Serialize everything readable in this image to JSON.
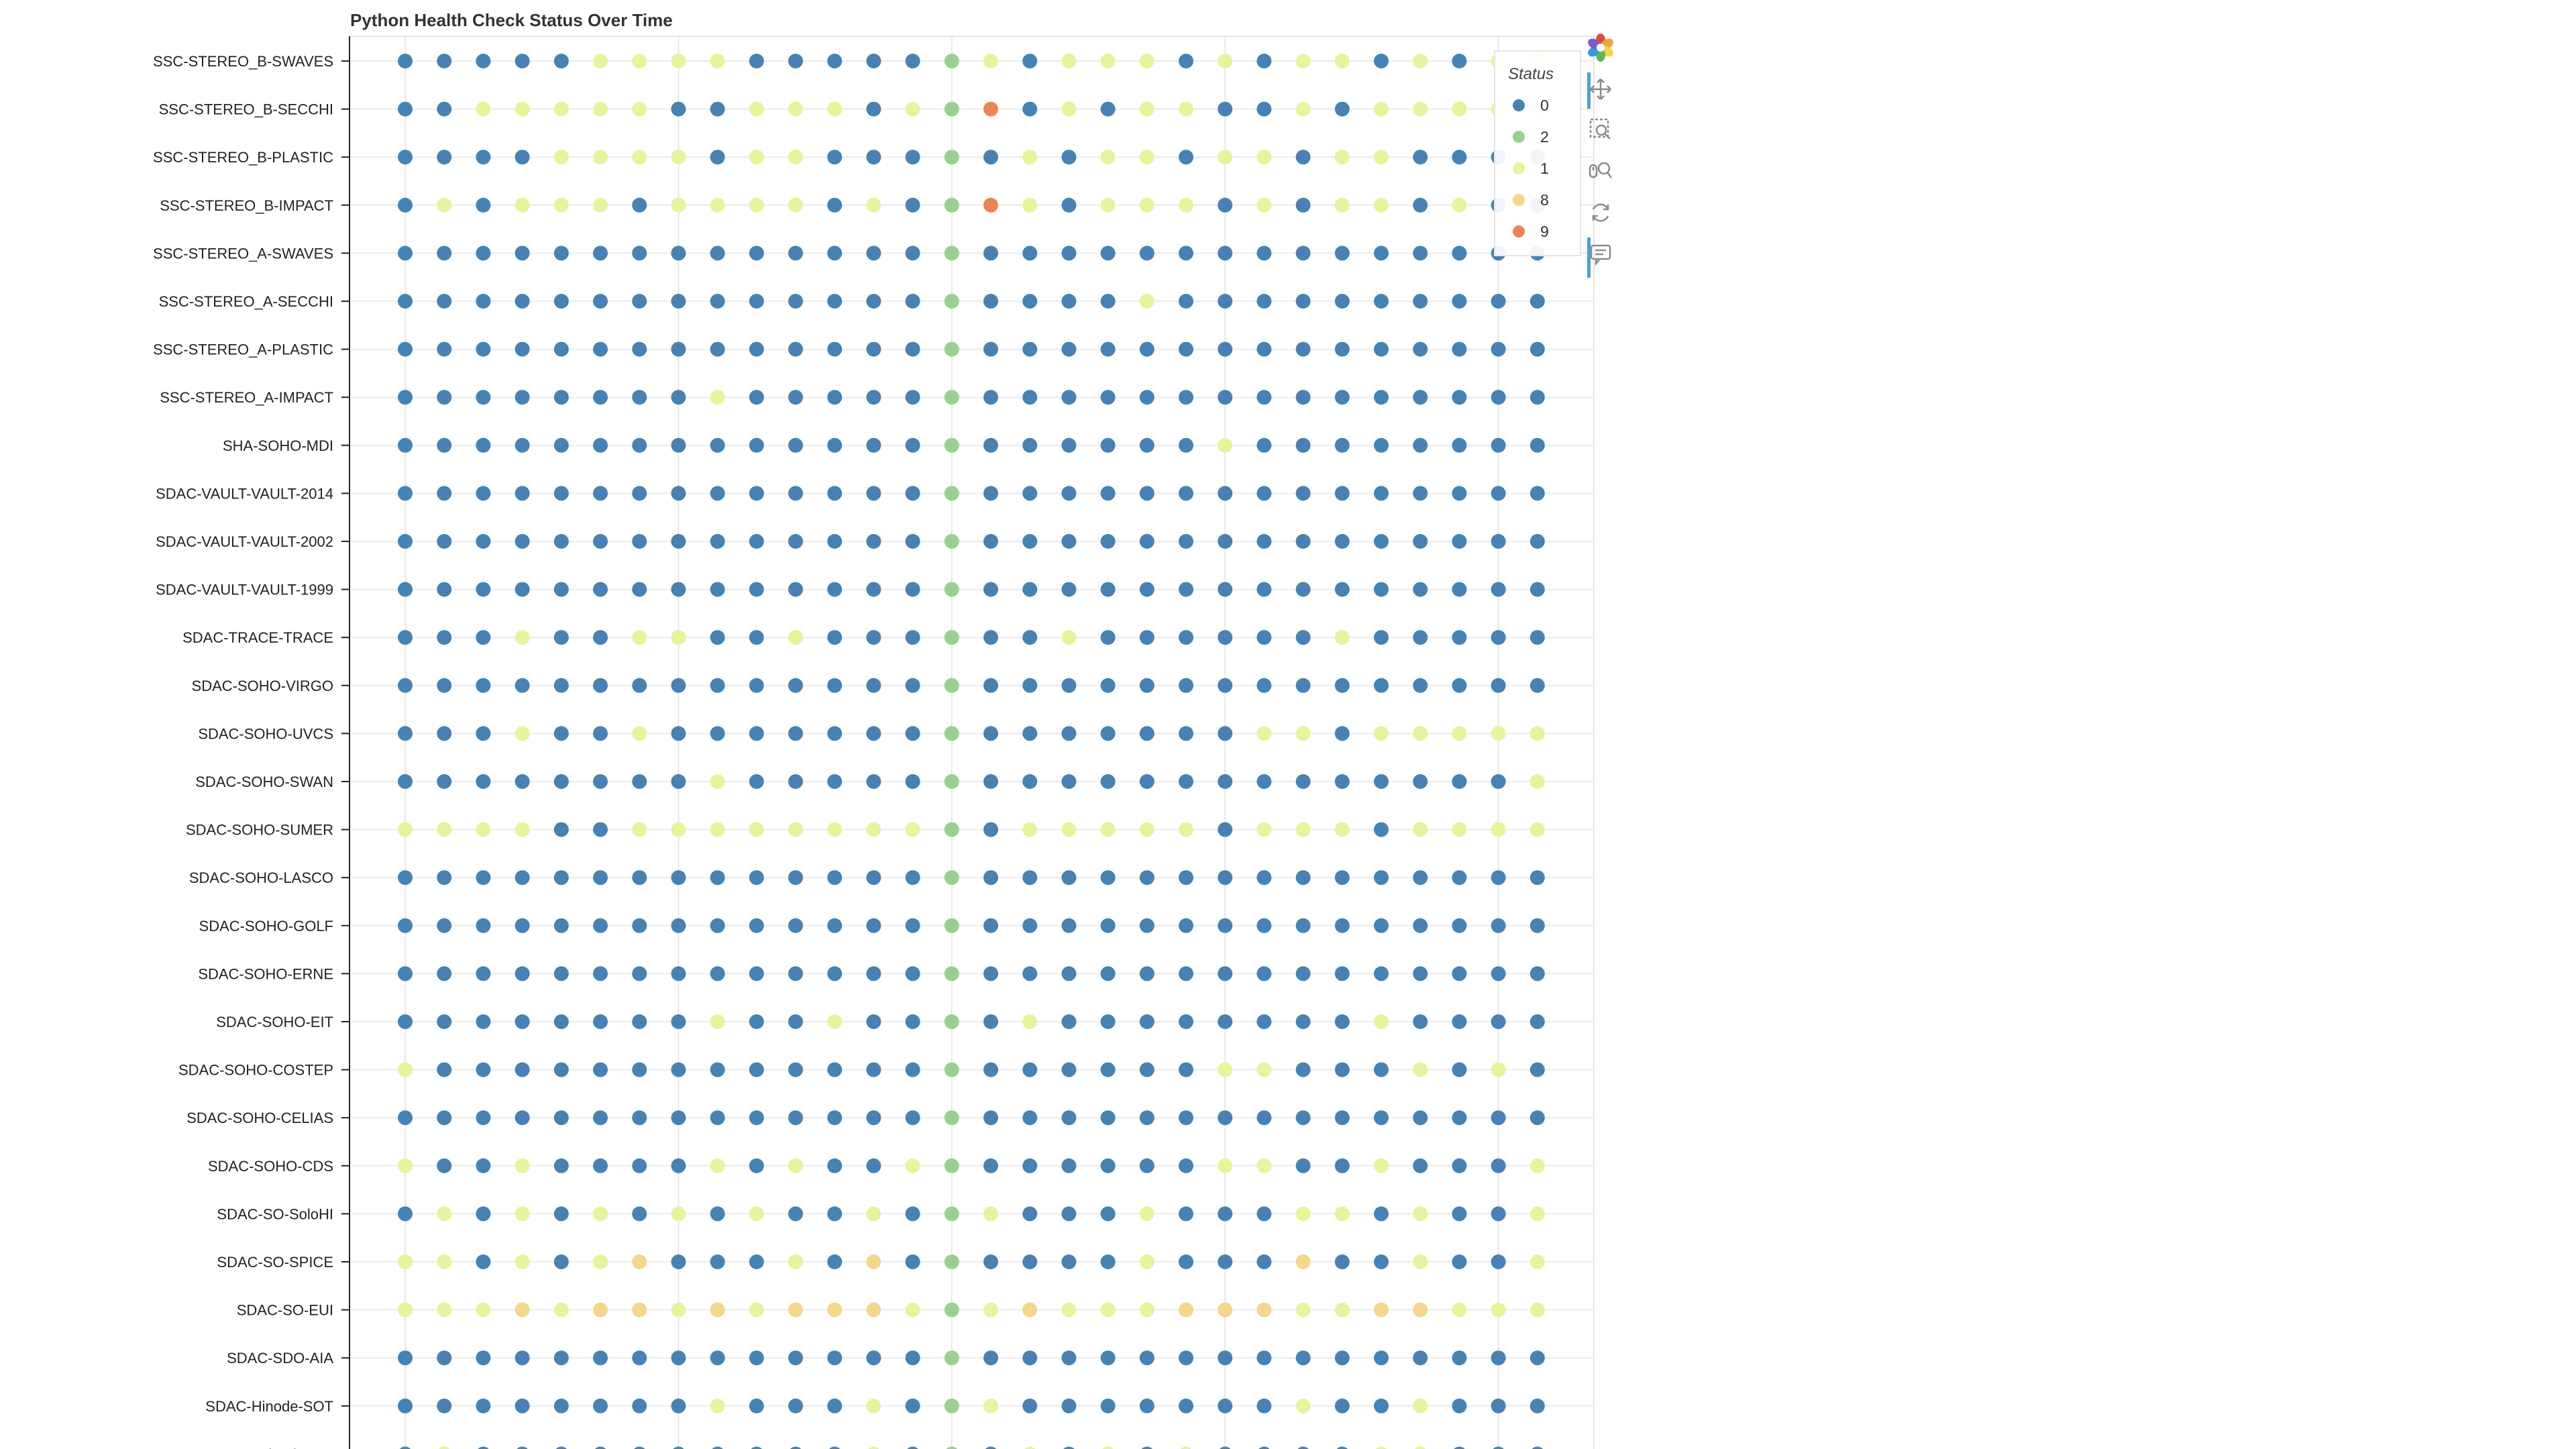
{
  "chart_data": {
    "type": "scatter",
    "title": "Python Health Check Status Over Time",
    "categories": [
      "SSC-STEREO_B-SWAVES",
      "SSC-STEREO_B-SECCHI",
      "SSC-STEREO_B-PLASTIC",
      "SSC-STEREO_B-IMPACT",
      "SSC-STEREO_A-SWAVES",
      "SSC-STEREO_A-SECCHI",
      "SSC-STEREO_A-PLASTIC",
      "SSC-STEREO_A-IMPACT",
      "SHA-SOHO-MDI",
      "SDAC-VAULT-VAULT-2014",
      "SDAC-VAULT-VAULT-2002",
      "SDAC-VAULT-VAULT-1999",
      "SDAC-TRACE-TRACE",
      "SDAC-SOHO-VIRGO",
      "SDAC-SOHO-UVCS",
      "SDAC-SOHO-SWAN",
      "SDAC-SOHO-SUMER",
      "SDAC-SOHO-LASCO",
      "SDAC-SOHO-GOLF",
      "SDAC-SOHO-ERNE",
      "SDAC-SOHO-EIT",
      "SDAC-SOHO-COSTEP",
      "SDAC-SOHO-CELIAS",
      "SDAC-SOHO-CDS",
      "SDAC-SO-SoloHI",
      "SDAC-SO-SPICE",
      "SDAC-SO-EUI",
      "SDAC-SDO-AIA",
      "SDAC-Hinode-SOT",
      "SDAC-Hinode-EIS"
    ],
    "series": [
      {
        "values": [
          0,
          0,
          0,
          0,
          0,
          1,
          1,
          1,
          1,
          0,
          0,
          0,
          0,
          0,
          2,
          1,
          0,
          1,
          1,
          1,
          0,
          1,
          0,
          1,
          1,
          0,
          1,
          0,
          1,
          1
        ]
      },
      {
        "values": [
          0,
          0,
          1,
          1,
          1,
          1,
          1,
          0,
          0,
          1,
          1,
          1,
          0,
          1,
          2,
          9,
          0,
          1,
          0,
          1,
          1,
          0,
          0,
          1,
          0,
          1,
          1,
          1,
          1,
          1
        ]
      },
      {
        "values": [
          0,
          0,
          0,
          0,
          1,
          1,
          1,
          1,
          0,
          1,
          1,
          0,
          0,
          0,
          2,
          0,
          1,
          0,
          1,
          1,
          0,
          1,
          1,
          0,
          1,
          1,
          0,
          0,
          0,
          0
        ]
      },
      {
        "values": [
          0,
          1,
          0,
          1,
          1,
          1,
          0,
          1,
          1,
          1,
          1,
          0,
          1,
          0,
          2,
          9,
          1,
          0,
          1,
          1,
          1,
          0,
          1,
          0,
          1,
          1,
          0,
          1,
          0,
          0
        ]
      },
      {
        "values": [
          0,
          0,
          0,
          0,
          0,
          0,
          0,
          0,
          0,
          0,
          0,
          0,
          0,
          0,
          2,
          0,
          0,
          0,
          0,
          0,
          0,
          0,
          0,
          0,
          0,
          0,
          0,
          0,
          0,
          0
        ]
      },
      {
        "values": [
          0,
          0,
          0,
          0,
          0,
          0,
          0,
          0,
          0,
          0,
          0,
          0,
          0,
          0,
          2,
          0,
          0,
          0,
          0,
          1,
          0,
          0,
          0,
          0,
          0,
          0,
          0,
          0,
          0,
          0
        ]
      },
      {
        "values": [
          0,
          0,
          0,
          0,
          0,
          0,
          0,
          0,
          0,
          0,
          0,
          0,
          0,
          0,
          2,
          0,
          0,
          0,
          0,
          0,
          0,
          0,
          0,
          0,
          0,
          0,
          0,
          0,
          0,
          0
        ]
      },
      {
        "values": [
          0,
          0,
          0,
          0,
          0,
          0,
          0,
          0,
          1,
          0,
          0,
          0,
          0,
          0,
          2,
          0,
          0,
          0,
          0,
          0,
          0,
          0,
          0,
          0,
          0,
          0,
          0,
          0,
          0,
          0
        ]
      },
      {
        "values": [
          0,
          0,
          0,
          0,
          0,
          0,
          0,
          0,
          0,
          0,
          0,
          0,
          0,
          0,
          2,
          0,
          0,
          0,
          0,
          0,
          0,
          1,
          0,
          0,
          0,
          0,
          0,
          0,
          0,
          0
        ]
      },
      {
        "values": [
          0,
          0,
          0,
          0,
          0,
          0,
          0,
          0,
          0,
          0,
          0,
          0,
          0,
          0,
          2,
          0,
          0,
          0,
          0,
          0,
          0,
          0,
          0,
          0,
          0,
          0,
          0,
          0,
          0,
          0
        ]
      },
      {
        "values": [
          0,
          0,
          0,
          0,
          0,
          0,
          0,
          0,
          0,
          0,
          0,
          0,
          0,
          0,
          2,
          0,
          0,
          0,
          0,
          0,
          0,
          0,
          0,
          0,
          0,
          0,
          0,
          0,
          0,
          0
        ]
      },
      {
        "values": [
          0,
          0,
          0,
          0,
          0,
          0,
          0,
          0,
          0,
          0,
          0,
          0,
          0,
          0,
          2,
          0,
          0,
          0,
          0,
          0,
          0,
          0,
          0,
          0,
          0,
          0,
          0,
          0,
          0,
          0
        ]
      },
      {
        "values": [
          0,
          0,
          0,
          1,
          0,
          0,
          1,
          1,
          0,
          0,
          1,
          0,
          0,
          0,
          2,
          0,
          0,
          1,
          0,
          0,
          0,
          0,
          0,
          0,
          1,
          0,
          0,
          0,
          0,
          0
        ]
      },
      {
        "values": [
          0,
          0,
          0,
          0,
          0,
          0,
          0,
          0,
          0,
          0,
          0,
          0,
          0,
          0,
          2,
          0,
          0,
          0,
          0,
          0,
          0,
          0,
          0,
          0,
          0,
          0,
          0,
          0,
          0,
          0
        ]
      },
      {
        "values": [
          0,
          0,
          0,
          1,
          0,
          0,
          1,
          0,
          0,
          0,
          0,
          0,
          0,
          0,
          2,
          0,
          0,
          0,
          0,
          0,
          0,
          0,
          1,
          1,
          0,
          1,
          1,
          1,
          1,
          1
        ]
      },
      {
        "values": [
          0,
          0,
          0,
          0,
          0,
          0,
          0,
          0,
          1,
          0,
          0,
          0,
          0,
          0,
          2,
          0,
          0,
          0,
          0,
          0,
          0,
          0,
          0,
          0,
          0,
          0,
          0,
          0,
          0,
          1
        ]
      },
      {
        "values": [
          1,
          1,
          1,
          1,
          0,
          0,
          1,
          1,
          1,
          1,
          1,
          1,
          1,
          1,
          2,
          0,
          1,
          1,
          1,
          1,
          1,
          0,
          1,
          1,
          1,
          0,
          1,
          1,
          1,
          1
        ]
      },
      {
        "values": [
          0,
          0,
          0,
          0,
          0,
          0,
          0,
          0,
          0,
          0,
          0,
          0,
          0,
          0,
          2,
          0,
          0,
          0,
          0,
          0,
          0,
          0,
          0,
          0,
          0,
          0,
          0,
          0,
          0,
          0
        ]
      },
      {
        "values": [
          0,
          0,
          0,
          0,
          0,
          0,
          0,
          0,
          0,
          0,
          0,
          0,
          0,
          0,
          2,
          0,
          0,
          0,
          0,
          0,
          0,
          0,
          0,
          0,
          0,
          0,
          0,
          0,
          0,
          0
        ]
      },
      {
        "values": [
          0,
          0,
          0,
          0,
          0,
          0,
          0,
          0,
          0,
          0,
          0,
          0,
          0,
          0,
          2,
          0,
          0,
          0,
          0,
          0,
          0,
          0,
          0,
          0,
          0,
          0,
          0,
          0,
          0,
          0
        ]
      },
      {
        "values": [
          0,
          0,
          0,
          0,
          0,
          0,
          0,
          0,
          1,
          0,
          0,
          1,
          0,
          0,
          2,
          0,
          1,
          0,
          0,
          0,
          0,
          0,
          0,
          0,
          0,
          1,
          0,
          0,
          0,
          0
        ]
      },
      {
        "values": [
          1,
          0,
          0,
          0,
          0,
          0,
          0,
          0,
          0,
          0,
          0,
          0,
          0,
          0,
          2,
          0,
          0,
          0,
          0,
          0,
          0,
          1,
          1,
          0,
          0,
          0,
          1,
          0,
          1,
          0
        ]
      },
      {
        "values": [
          0,
          0,
          0,
          0,
          0,
          0,
          0,
          0,
          0,
          0,
          0,
          0,
          0,
          0,
          2,
          0,
          0,
          0,
          0,
          0,
          0,
          0,
          0,
          0,
          0,
          0,
          0,
          0,
          0,
          0
        ]
      },
      {
        "values": [
          1,
          0,
          0,
          1,
          0,
          0,
          0,
          0,
          1,
          0,
          1,
          0,
          0,
          1,
          2,
          0,
          0,
          0,
          0,
          0,
          0,
          1,
          1,
          0,
          0,
          1,
          0,
          0,
          0,
          1
        ]
      },
      {
        "values": [
          0,
          1,
          0,
          1,
          0,
          1,
          0,
          1,
          0,
          1,
          0,
          0,
          1,
          0,
          2,
          1,
          0,
          0,
          0,
          1,
          0,
          0,
          0,
          1,
          1,
          0,
          1,
          0,
          0,
          1
        ]
      },
      {
        "values": [
          1,
          1,
          0,
          1,
          0,
          1,
          8,
          0,
          0,
          0,
          1,
          0,
          8,
          0,
          2,
          0,
          0,
          0,
          0,
          1,
          0,
          0,
          0,
          8,
          0,
          0,
          1,
          0,
          0,
          1
        ]
      },
      {
        "values": [
          1,
          1,
          1,
          8,
          1,
          8,
          8,
          1,
          8,
          1,
          8,
          8,
          8,
          1,
          2,
          1,
          8,
          1,
          1,
          1,
          8,
          8,
          8,
          1,
          1,
          8,
          8,
          1,
          1,
          1
        ]
      },
      {
        "values": [
          0,
          0,
          0,
          0,
          0,
          0,
          0,
          0,
          0,
          0,
          0,
          0,
          0,
          0,
          2,
          0,
          0,
          0,
          0,
          0,
          0,
          0,
          0,
          0,
          0,
          0,
          0,
          0,
          0,
          0
        ]
      },
      {
        "values": [
          0,
          0,
          0,
          0,
          0,
          0,
          0,
          0,
          1,
          0,
          0,
          0,
          1,
          0,
          2,
          1,
          0,
          0,
          0,
          0,
          0,
          0,
          0,
          1,
          0,
          0,
          1,
          0,
          0,
          0
        ]
      },
      {
        "values": [
          0,
          1,
          0,
          0,
          0,
          0,
          0,
          0,
          0,
          0,
          0,
          0,
          1,
          0,
          2,
          0,
          1,
          0,
          1,
          0,
          1,
          0,
          0,
          0,
          0,
          1,
          1,
          0,
          0,
          0
        ]
      }
    ],
    "legend": {
      "title": "Status",
      "placement": "top-right",
      "items": [
        {
          "label": "0",
          "color": "#4682b4"
        },
        {
          "label": "2",
          "color": "#99d08f"
        },
        {
          "label": "1",
          "color": "#e6f49b"
        },
        {
          "label": "8",
          "color": "#f5d68a"
        },
        {
          "label": "9",
          "color": "#ec8554"
        }
      ]
    },
    "grid": true,
    "xlabel": "",
    "ylabel": ""
  },
  "toolbar": {
    "tools": [
      {
        "name": "bokeh-logo-icon"
      },
      {
        "name": "pan-icon"
      },
      {
        "name": "box-zoom-icon"
      },
      {
        "name": "wheel-zoom-icon"
      },
      {
        "name": "reset-icon"
      },
      {
        "name": "hover-icon"
      }
    ]
  }
}
